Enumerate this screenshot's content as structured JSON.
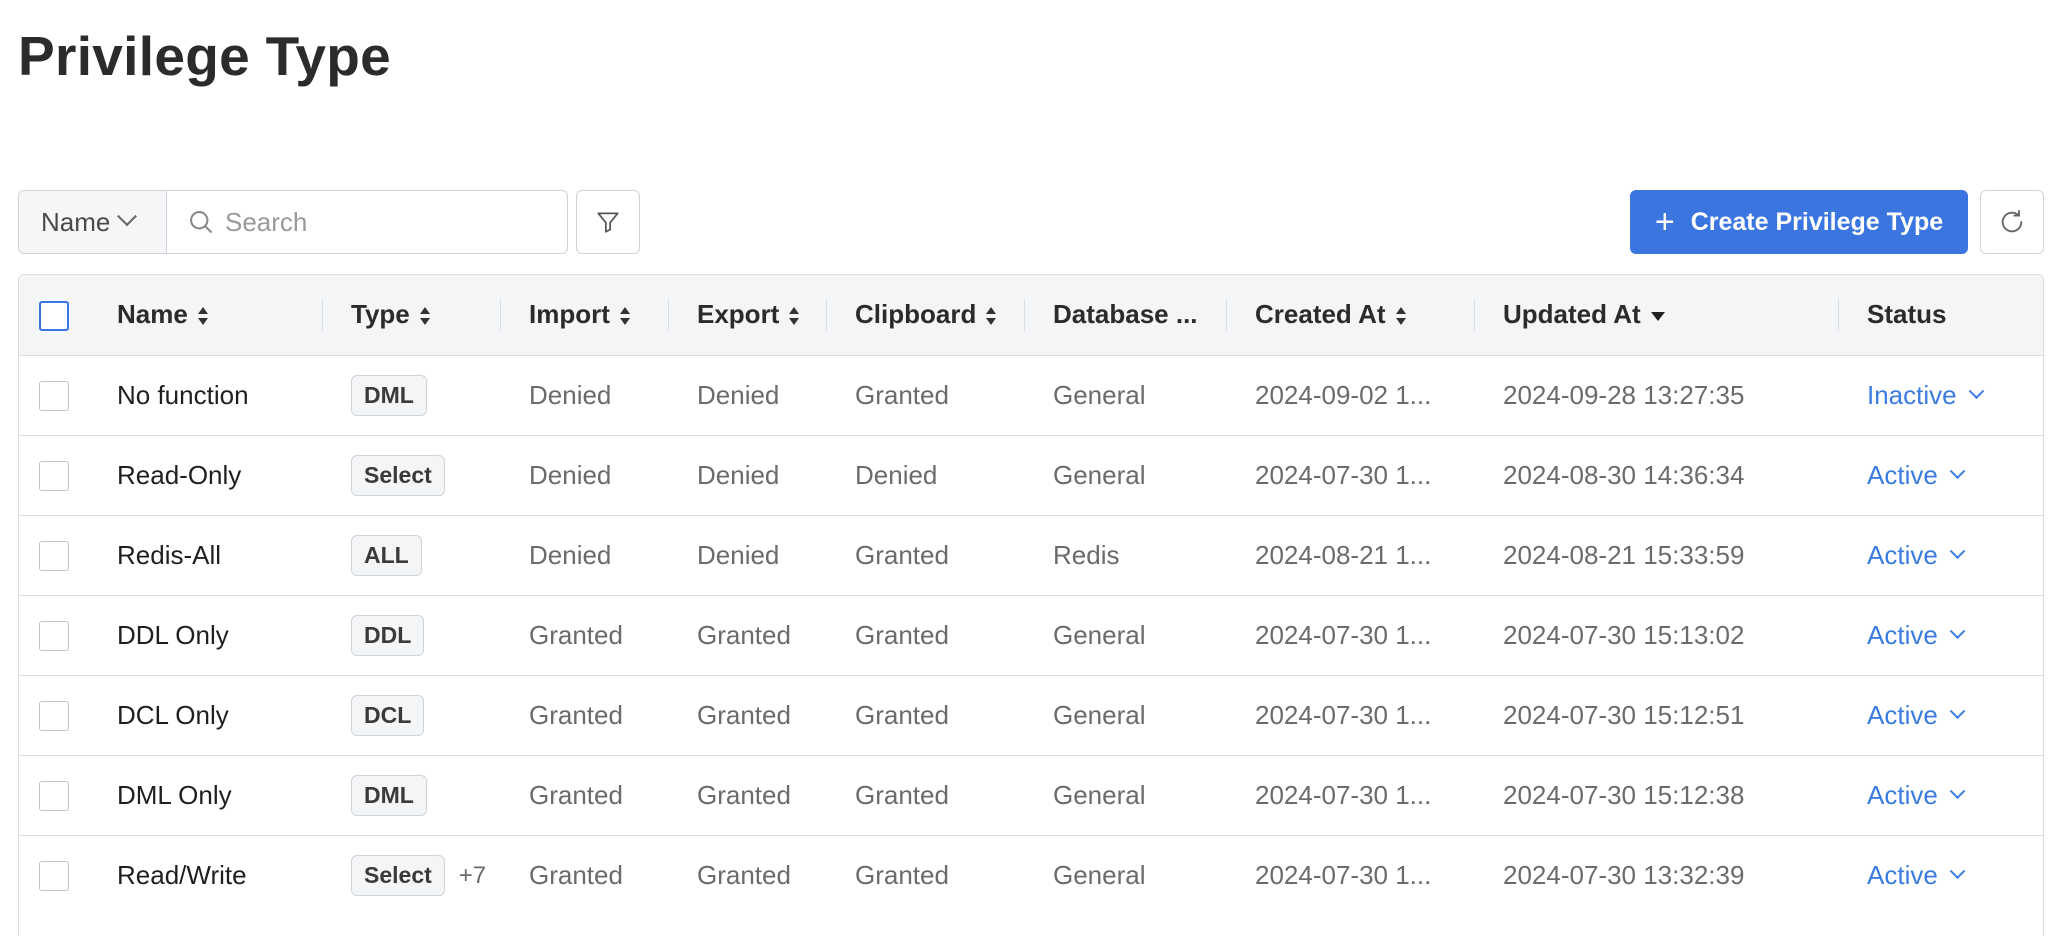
{
  "page": {
    "title": "Privilege Type"
  },
  "toolbar": {
    "field_select": "Name",
    "search_placeholder": "Search",
    "create_label": "Create Privilege Type",
    "icons": {
      "search": "search-icon",
      "filter": "filter-icon",
      "refresh": "refresh-icon",
      "plus": "plus-icon"
    }
  },
  "colors": {
    "primary": "#3b75e0",
    "status_link": "#3b7ce0"
  },
  "table": {
    "columns": [
      "Name",
      "Type",
      "Import",
      "Export",
      "Clipboard",
      "Database ...",
      "Created At",
      "Updated At",
      "Status"
    ],
    "rows": [
      {
        "name": "No function",
        "type": "DML",
        "extra": "",
        "import": "Denied",
        "export": "Denied",
        "clipboard": "Granted",
        "database": "General",
        "created_at": "2024-09-02 1...",
        "updated_at": "2024-09-28 13:27:35",
        "status": "Inactive"
      },
      {
        "name": "Read-Only",
        "type": "Select",
        "extra": "",
        "import": "Denied",
        "export": "Denied",
        "clipboard": "Denied",
        "database": "General",
        "created_at": "2024-07-30 1...",
        "updated_at": "2024-08-30 14:36:34",
        "status": "Active"
      },
      {
        "name": "Redis-All",
        "type": "ALL",
        "extra": "",
        "import": "Denied",
        "export": "Denied",
        "clipboard": "Granted",
        "database": "Redis",
        "created_at": "2024-08-21 1...",
        "updated_at": "2024-08-21 15:33:59",
        "status": "Active"
      },
      {
        "name": "DDL Only",
        "type": "DDL",
        "extra": "",
        "import": "Granted",
        "export": "Granted",
        "clipboard": "Granted",
        "database": "General",
        "created_at": "2024-07-30 1...",
        "updated_at": "2024-07-30 15:13:02",
        "status": "Active"
      },
      {
        "name": "DCL Only",
        "type": "DCL",
        "extra": "",
        "import": "Granted",
        "export": "Granted",
        "clipboard": "Granted",
        "database": "General",
        "created_at": "2024-07-30 1...",
        "updated_at": "2024-07-30 15:12:51",
        "status": "Active"
      },
      {
        "name": "DML Only",
        "type": "DML",
        "extra": "",
        "import": "Granted",
        "export": "Granted",
        "clipboard": "Granted",
        "database": "General",
        "created_at": "2024-07-30 1...",
        "updated_at": "2024-07-30 15:12:38",
        "status": "Active"
      },
      {
        "name": "Read/Write",
        "type": "Select",
        "extra": "+7",
        "import": "Granted",
        "export": "Granted",
        "clipboard": "Granted",
        "database": "General",
        "created_at": "2024-07-30 1...",
        "updated_at": "2024-07-30 13:32:39",
        "status": "Active"
      }
    ]
  }
}
